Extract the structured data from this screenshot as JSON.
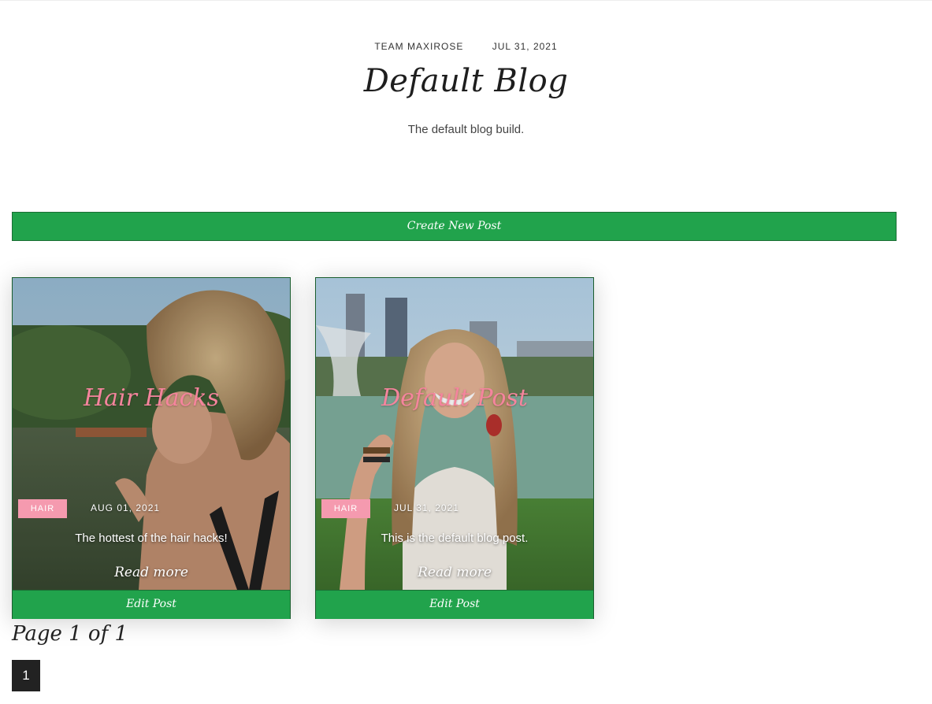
{
  "header": {
    "author": "TEAM MAXIROSE",
    "date": "JUL 31, 2021",
    "title": "Default Blog",
    "subtitle": "The default blog build."
  },
  "actions": {
    "create_label": "Create New Post"
  },
  "posts": [
    {
      "title": "Hair Hacks",
      "category": "HAIR",
      "date": "AUG 01, 2021",
      "excerpt": "The hottest of the hair hacks!",
      "read_more": "Read more",
      "edit_label": "Edit Post"
    },
    {
      "title": "Default Post",
      "category": "HAIR",
      "date": "JUL 31, 2021",
      "excerpt": "This is the default blog post.",
      "read_more": "Read more",
      "edit_label": "Edit Post"
    }
  ],
  "pagination": {
    "label": "Page 1 of 1",
    "pages": [
      "1"
    ]
  },
  "colors": {
    "accent_green": "#21a34c",
    "badge_pink": "#f59aaf",
    "title_pink": "#f5849d"
  }
}
